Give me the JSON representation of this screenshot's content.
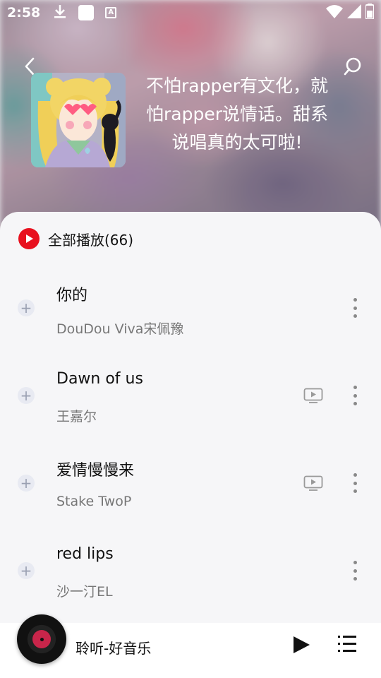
{
  "status_bar": {
    "time": "2:58",
    "icons": [
      "download-icon",
      "app-icon",
      "a-icon",
      "wifi-icon",
      "signal-icon",
      "battery-icon"
    ]
  },
  "header": {
    "back_icon": "chevron-left-icon",
    "search_icon": "search-icon",
    "title_lines": [
      "不怕rapper有文化，就",
      "怕rapper说情话。甜系",
      "说唱真的太可啦!"
    ]
  },
  "play_all": {
    "label": "全部播放(66)",
    "icon": "play-circle-icon",
    "accent": "#e8111f"
  },
  "songs": [
    {
      "title": "你的",
      "artist": "DouDou Viva宋佩豫",
      "has_mv": false
    },
    {
      "title": "Dawn of us",
      "artist": "王嘉尔",
      "has_mv": true
    },
    {
      "title": "爱情慢慢来",
      "artist": "Stake TwoP",
      "has_mv": true
    },
    {
      "title": "red lips",
      "artist": "沙一汀EL",
      "has_mv": false
    }
  ],
  "mini_player": {
    "label": "聆听-好音乐",
    "play_icon": "play-icon",
    "playlist_icon": "playlist-icon"
  }
}
